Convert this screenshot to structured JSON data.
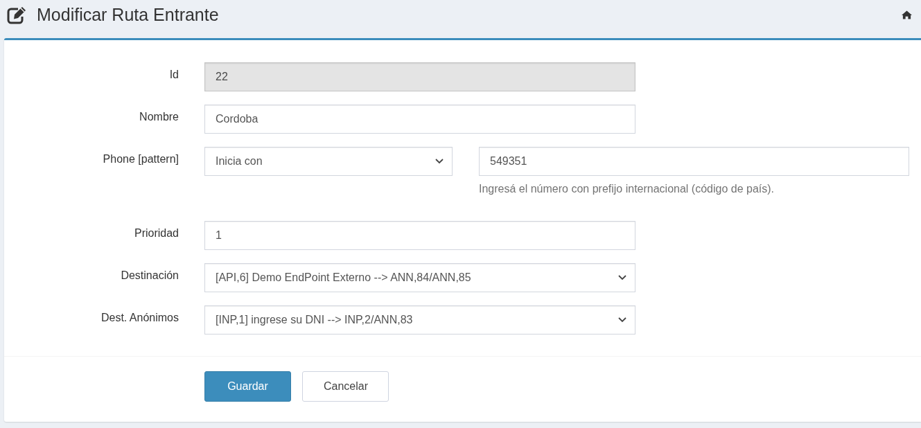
{
  "header": {
    "title": "Modificar Ruta Entrante"
  },
  "form": {
    "fields": [
      {
        "kind": "text",
        "label": "Id",
        "value": "22",
        "disabled": true
      },
      {
        "kind": "text",
        "label": "Nombre",
        "value": "Cordoba",
        "disabled": false
      },
      {
        "kind": "pattern",
        "label": "Phone [pattern]",
        "match": "Inicia con",
        "value": "549351",
        "help": "Ingresá el número con prefijo internacional (código de país).",
        "disabled": false
      },
      {
        "kind": "text",
        "label": "Prioridad",
        "value": "1",
        "disabled": false
      },
      {
        "kind": "select",
        "label": "Destinación",
        "value": "[API,6] Demo EndPoint Externo --> ANN,84/ANN,85",
        "disabled": false
      },
      {
        "kind": "select",
        "label": "Dest. Anónimos",
        "value": "[INP,1] ingrese su DNI --> INP,2/ANN,83",
        "disabled": false
      }
    ]
  },
  "buttons": [
    {
      "kind": "submit",
      "label": "Guardar"
    },
    {
      "kind": "cancel",
      "label": "Cancelar"
    }
  ]
}
